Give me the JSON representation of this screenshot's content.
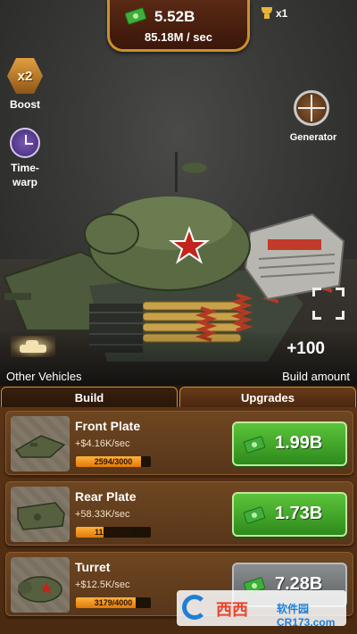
{
  "header": {
    "money": "5.52B",
    "rate": "85.18M / sec",
    "multiplier": "x1"
  },
  "side_buttons": {
    "boost_badge": "x2",
    "boost_label": "Boost",
    "timewarp_label_line1": "Time-",
    "timewarp_label_line2": "warp",
    "generator_label": "Generator"
  },
  "scene": {
    "other_vehicles_label": "Other Vehicles",
    "build_amount_value": "+100",
    "build_amount_label": "Build amount"
  },
  "tabs": [
    {
      "label": "Build",
      "active": true
    },
    {
      "label": "Upgrades",
      "active": false
    }
  ],
  "parts": [
    {
      "name": "Front Plate",
      "rate": "+$4.16K/sec",
      "progress_text": "2594/3000",
      "progress": 0.865,
      "price": "1.99B",
      "affordable": true,
      "icon": "front-plate-icon"
    },
    {
      "name": "Rear Plate",
      "rate": "+58.33K/sec",
      "progress_text": "1100/3000",
      "progress": 0.367,
      "price": "1.73B",
      "affordable": true,
      "icon": "rear-plate-icon"
    },
    {
      "name": "Turret",
      "rate": "+$12.5K/sec",
      "progress_text": "3179/4000",
      "progress": 0.795,
      "price": "7.28B",
      "affordable": false,
      "icon": "turret-icon"
    }
  ],
  "watermark": {
    "brand": "西西",
    "site": "软件园 CR173.com"
  },
  "colors": {
    "buy_enabled": "#3faa2c",
    "buy_disabled": "#72767a",
    "banner_border": "#c9912e",
    "progress_fill": "#f29a20"
  }
}
